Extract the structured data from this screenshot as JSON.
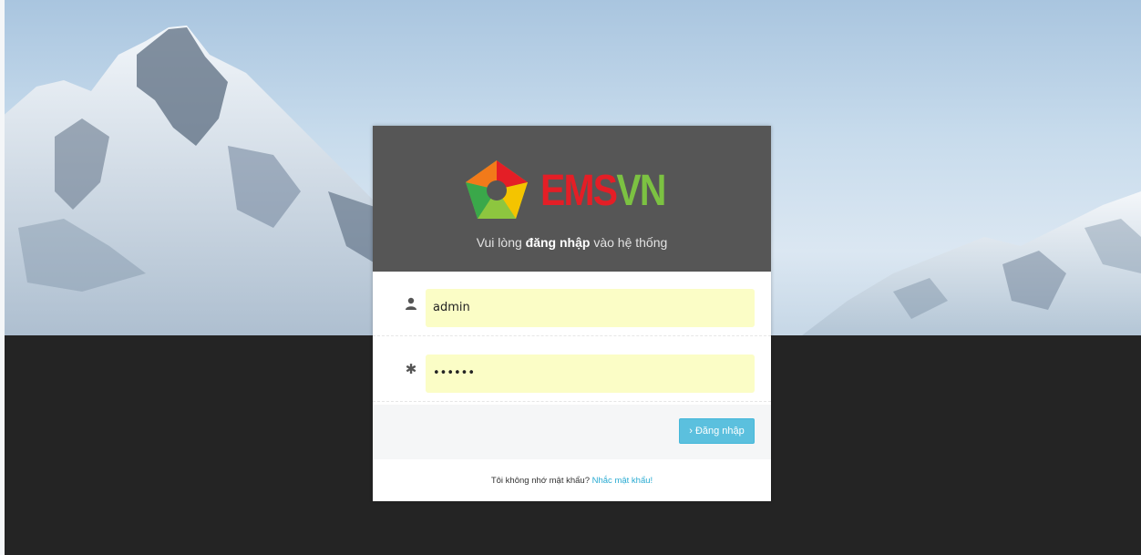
{
  "brand": {
    "logo_part1": "EMS",
    "logo_part2": "VN",
    "colors": {
      "red": "#e41e26",
      "green": "#7cc242",
      "yellow": "#f4c400",
      "orange": "#f27a1a"
    }
  },
  "header": {
    "tagline_before": "Vui lòng ",
    "tagline_bold": "đăng nhập",
    "tagline_after": " vào hệ thống"
  },
  "login_form": {
    "username": {
      "icon": "user-icon",
      "value": "admin"
    },
    "password": {
      "icon": "asterisk-icon",
      "value": "••••••"
    },
    "submit_label": "› Đăng nhập",
    "submit_color": "#5bc0de"
  },
  "footer": {
    "forgot_text": "Tôi không nhớ mật khẩu?",
    "forgot_link": "Nhắc mật khẩu!"
  }
}
